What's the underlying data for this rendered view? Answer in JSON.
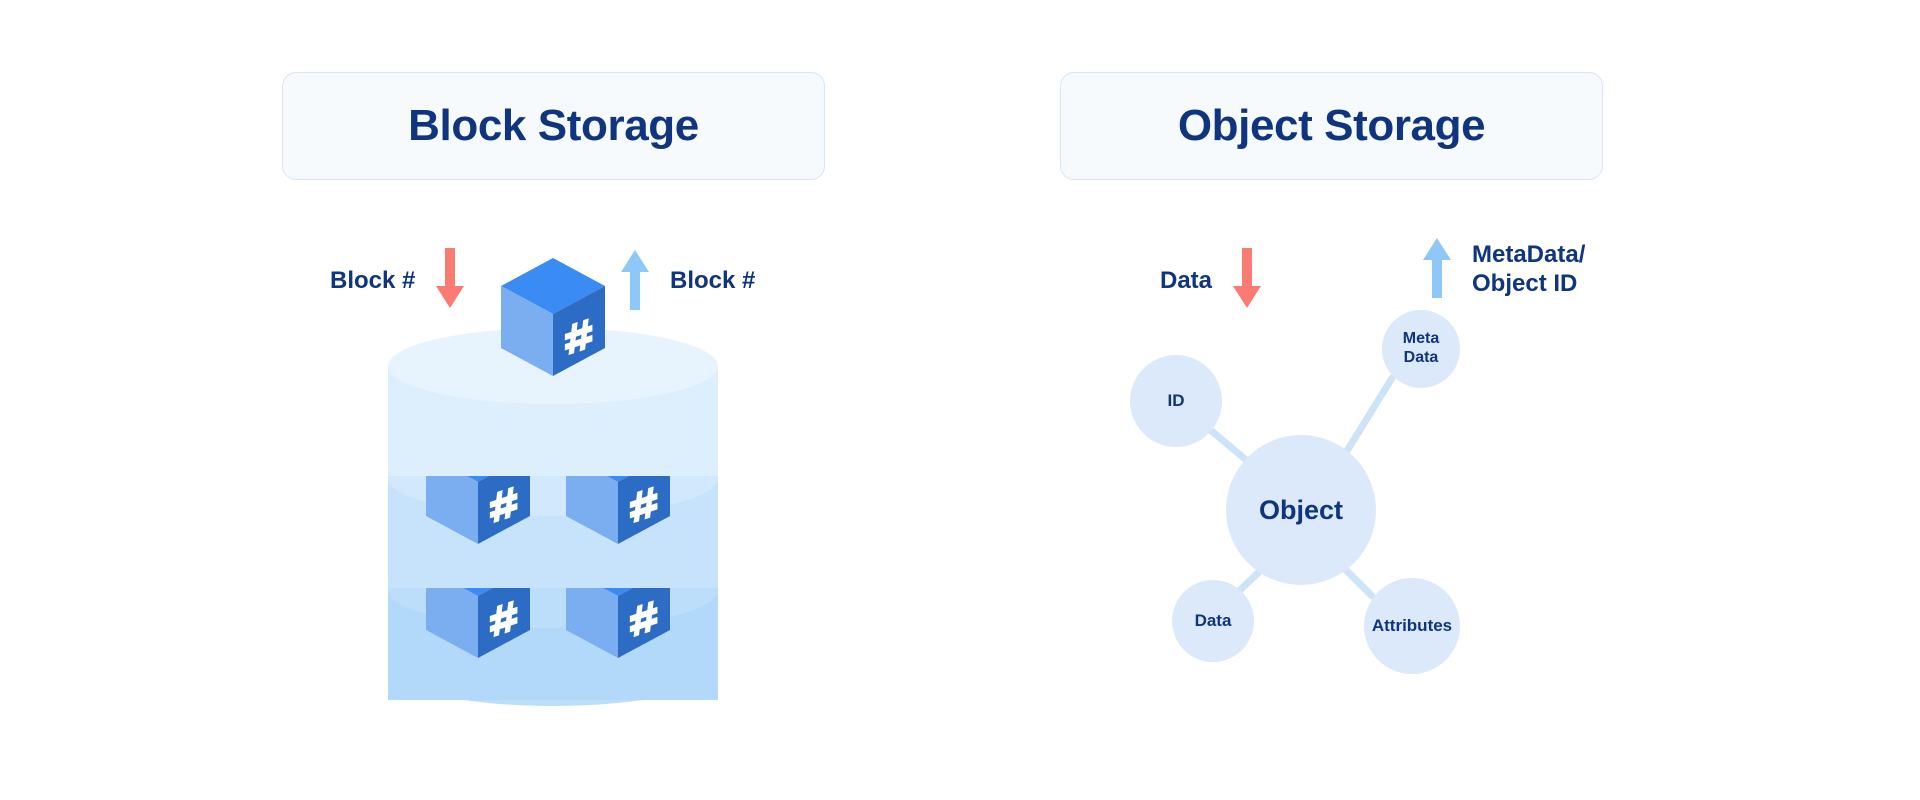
{
  "page": {
    "background": "#ffffff",
    "accent_navy": "#0f3580",
    "accent_blue": "#8ec8f8",
    "accent_red": "#fa7b72",
    "cube_top": "#3b8bf5",
    "cube_left": "#7aaef0",
    "cube_right": "#2c6cc4",
    "node_fill": "#dbe9fa",
    "card_fill": "#f7fafd",
    "card_border": "#d5e6f7"
  },
  "panels": [
    {
      "id": "block",
      "title": "Block Storage",
      "flows": [
        {
          "label": "Block #",
          "direction": "down",
          "color": "#fa7b72",
          "label_side": "left"
        },
        {
          "label": "Block #",
          "direction": "up",
          "color": "#8ec8f8",
          "label_side": "right"
        }
      ],
      "cylinder": {
        "layers": 3,
        "cube_label": "#",
        "cubes_per_layer": [
          1,
          2,
          2
        ]
      }
    },
    {
      "id": "object",
      "title": "Object Storage",
      "flows": [
        {
          "label": "Data",
          "direction": "down",
          "color": "#fa7b72",
          "label_side": "left"
        },
        {
          "label_line1": "MetaData/",
          "label_line2": "Object ID",
          "direction": "up",
          "color": "#8ec8f8",
          "label_side": "right"
        }
      ],
      "graph": {
        "center": "Object",
        "nodes": [
          {
            "id": "id",
            "label": "ID"
          },
          {
            "id": "metadata",
            "label_line1": "Meta",
            "label_line2": "Data"
          },
          {
            "id": "data",
            "label": "Data"
          },
          {
            "id": "attributes",
            "label": "Attributes"
          }
        ]
      }
    }
  ]
}
